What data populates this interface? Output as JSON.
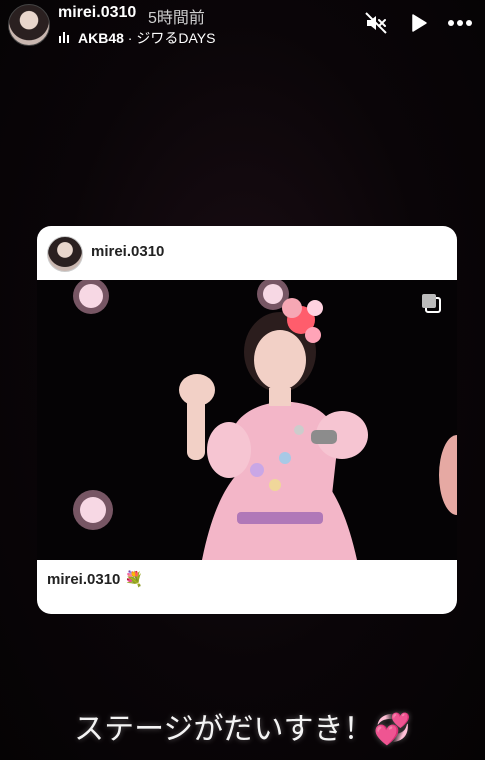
{
  "header": {
    "username": "mirei.0310",
    "time": "5時間前",
    "music": {
      "artist": "AKB48",
      "separator": " · ",
      "song": "ジワるDAYS"
    }
  },
  "icons": {
    "mute": "speaker-muted-icon",
    "play": "play-icon",
    "more": "more-dots-icon",
    "music": "music-bars-icon",
    "multi_photo": "multiple-photos-icon"
  },
  "card": {
    "username": "mirei.0310",
    "caption_user": "mirei.0310",
    "caption_emoji": "💐"
  },
  "story_text": "ステージがだいすき！💞",
  "colors": {
    "background": "#000000",
    "card": "#ffffff",
    "dress": "#f3b6c8",
    "flower": "#ff5d6c"
  }
}
